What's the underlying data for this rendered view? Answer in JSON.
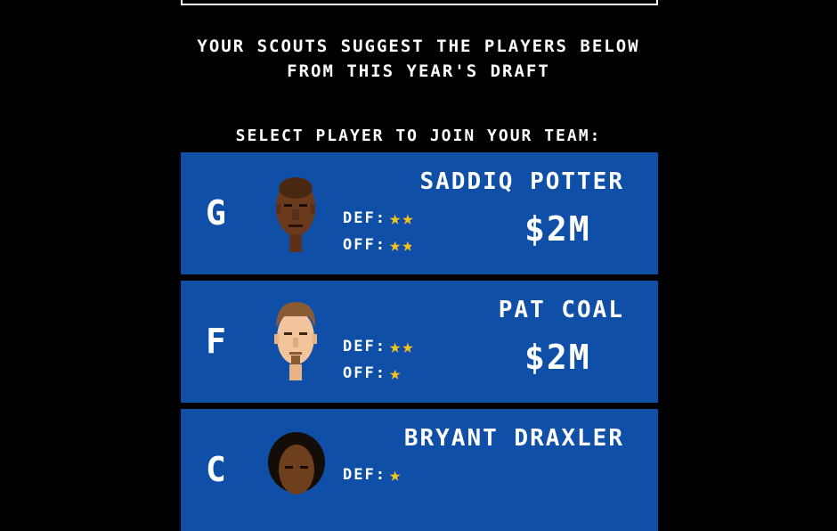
{
  "intro": {
    "line1": "YOUR SCOUTS SUGGEST THE PLAYERS BELOW",
    "line2": "FROM THIS YEAR'S DRAFT"
  },
  "select_prompt": "SELECT PLAYER TO JOIN YOUR TEAM:",
  "players": [
    {
      "position": "G",
      "name": "SADDIQ POTTER",
      "price": "$2M",
      "def_label": "DEF:",
      "off_label": "OFF:",
      "def_stars": 2,
      "off_stars": 1.5,
      "face_icon": "dark-skin-bald-player-face-icon"
    },
    {
      "position": "F",
      "name": "PAT COAL",
      "price": "$2M",
      "def_label": "DEF:",
      "off_label": "OFF:",
      "def_stars": 2,
      "off_stars": 1,
      "face_icon": "light-skin-brown-hair-goatee-player-face-icon"
    },
    {
      "position": "C",
      "name": "BRYANT DRAXLER",
      "price": "",
      "def_label": "DEF:",
      "off_label": "",
      "def_stars": 1,
      "off_stars": 0,
      "face_icon": "curly-black-hair-player-face-icon"
    }
  ],
  "colors": {
    "background": "#000000",
    "card": "#0f4fa8",
    "text": "#ffffff",
    "star": "#f3c21f"
  }
}
